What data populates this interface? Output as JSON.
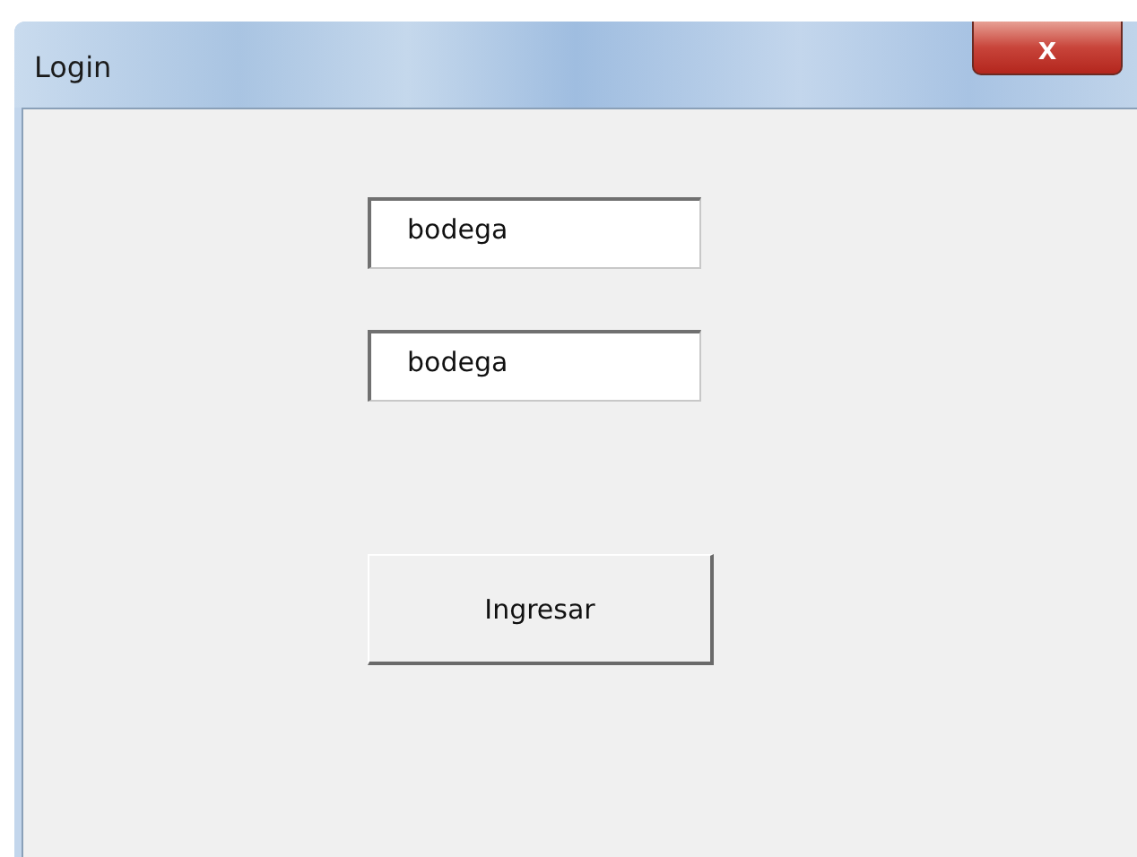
{
  "window": {
    "title": "Login",
    "close": "x"
  },
  "fields": [
    {
      "value": "bodega"
    },
    {
      "value": "bodega"
    }
  ],
  "buttons": [
    "Ingresar"
  ]
}
